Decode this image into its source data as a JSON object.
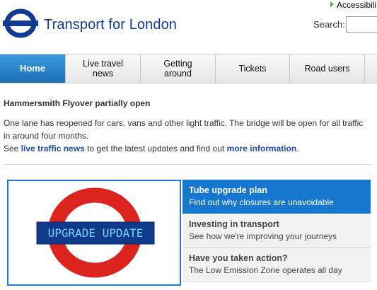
{
  "header": {
    "brand": "Transport for London",
    "accessibility": "Accessibili",
    "search_label": "Search:",
    "search_value": ""
  },
  "nav": {
    "items": [
      {
        "label": "Home"
      },
      {
        "label": "Live travel news"
      },
      {
        "label": "Getting around"
      },
      {
        "label": "Tickets"
      },
      {
        "label": "Road users"
      }
    ]
  },
  "news": {
    "title": "Hammersmith Flyover partially open",
    "body": "One lane has reopened for cars, vans and other light traffic. The bridge will be open for all traffic in around four months.",
    "see": "See",
    "link1": "live traffic news",
    "mid": "to get the latest updates and find out",
    "link2": "more information",
    "end": "."
  },
  "promo": {
    "banner_text": "UPGRADE UPDATE",
    "items": [
      {
        "title": "Tube upgrade plan",
        "subtitle": "Find out why closures are unavoidable"
      },
      {
        "title": "Investing in transport",
        "subtitle": "See how we're improving your journeys"
      },
      {
        "title": "Have you taken action?",
        "subtitle": "The Low Emission Zone operates all day"
      }
    ]
  },
  "colors": {
    "brand_blue": "#113b92",
    "roundel_red": "#dc241f",
    "nav_active": "#1d6fb5",
    "promo_active": "#1677cf"
  }
}
